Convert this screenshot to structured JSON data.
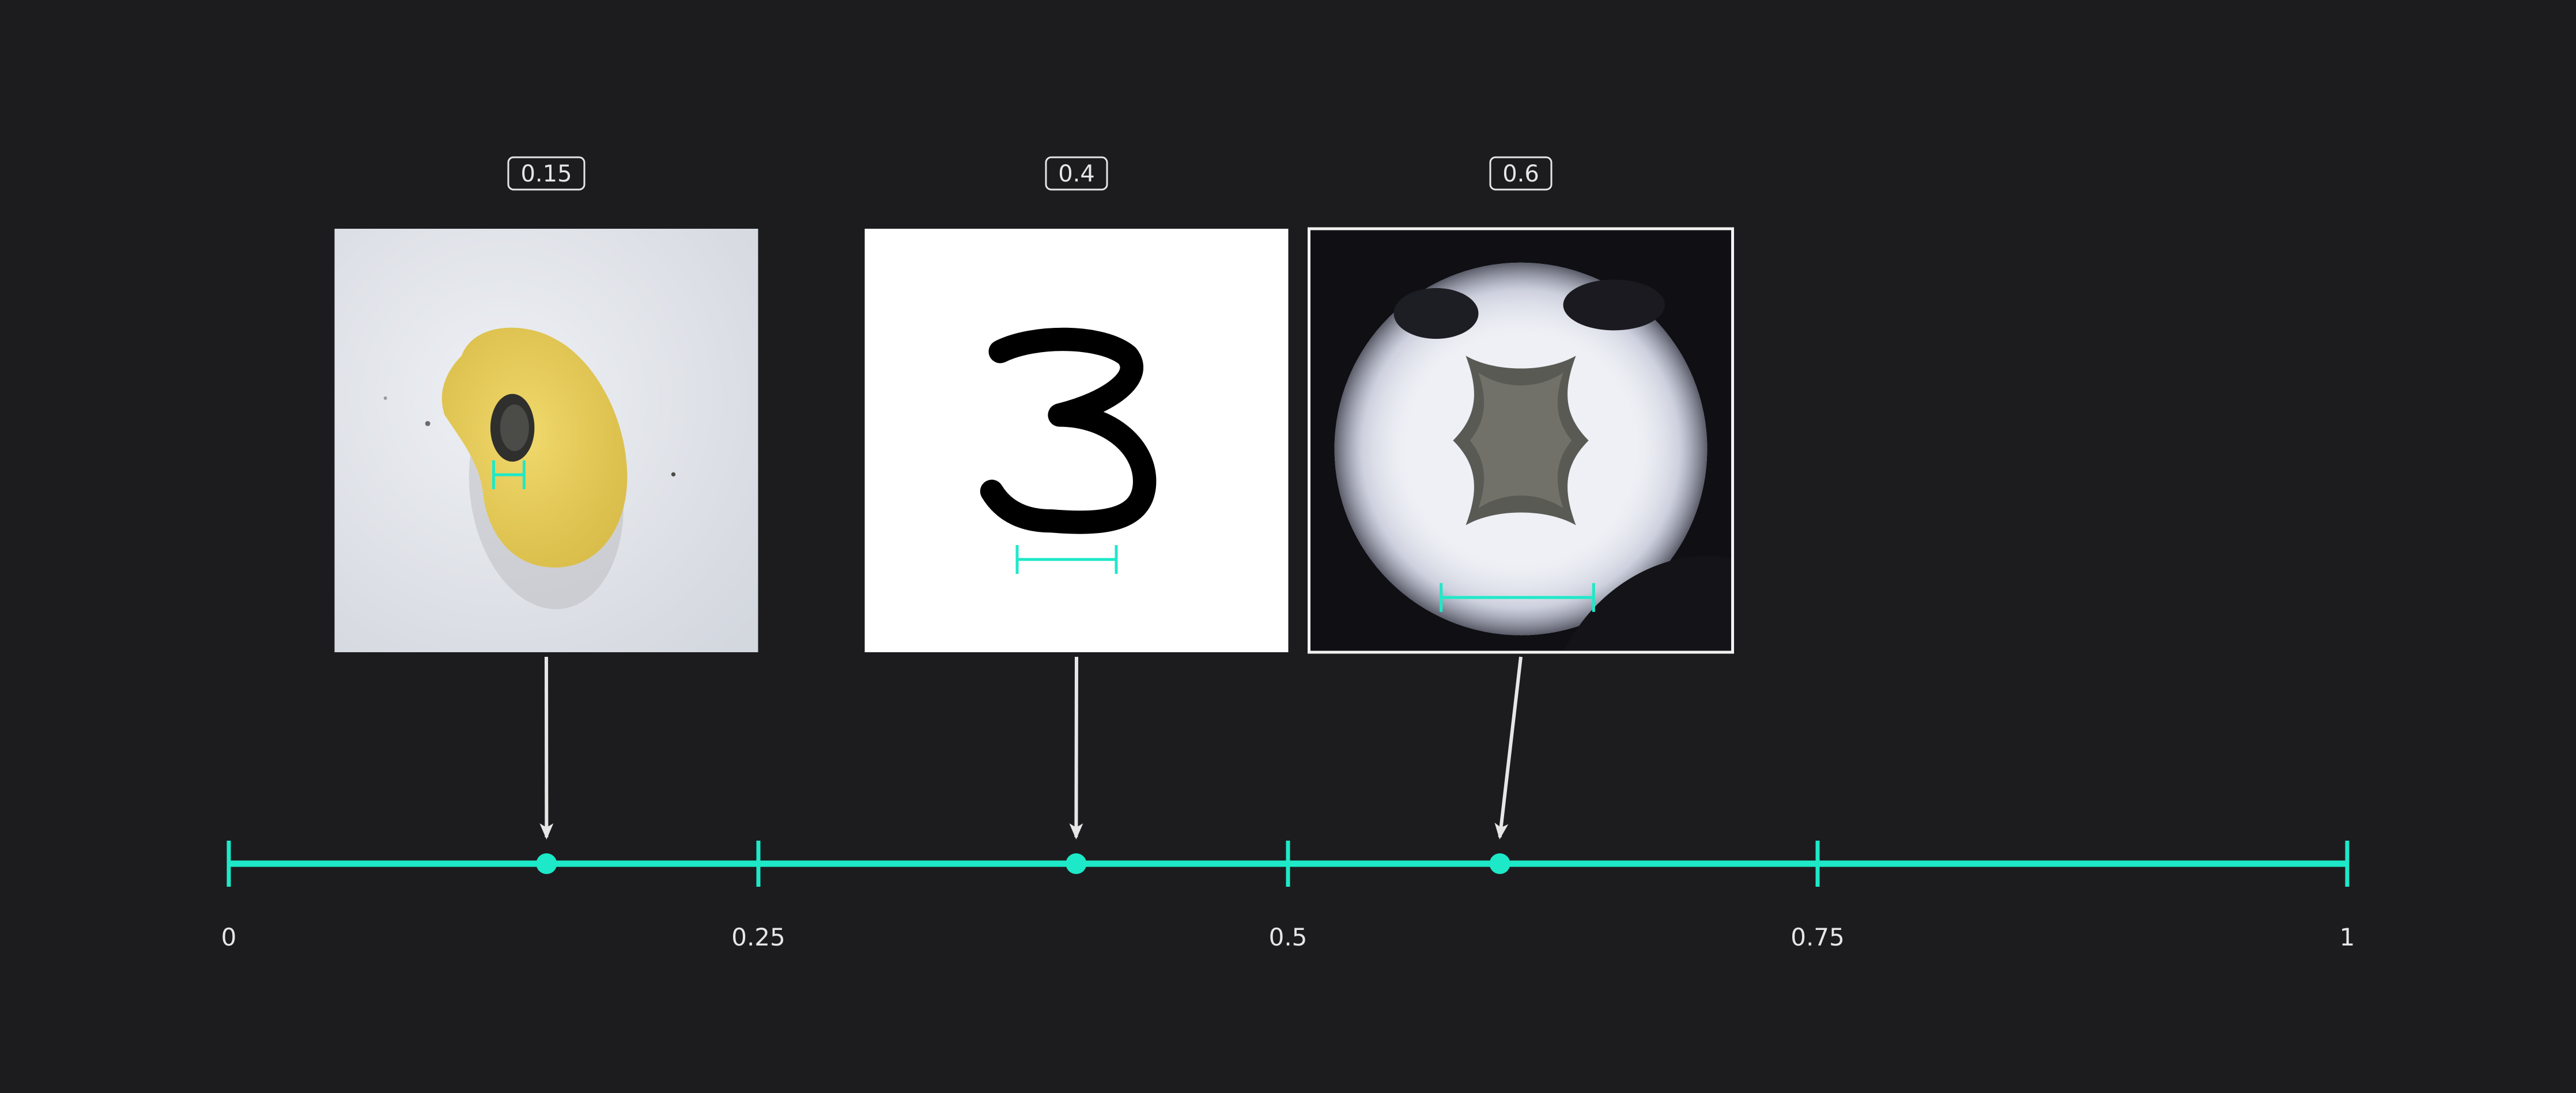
{
  "colors": {
    "background": "#1c1c1e",
    "accent": "#1de9c8",
    "foreground": "#e6e6e6"
  },
  "chart_data": {
    "type": "scatter",
    "xlim": [
      0,
      1
    ],
    "ticks": [
      {
        "value": 0,
        "label": "0"
      },
      {
        "value": 0.25,
        "label": "0.25"
      },
      {
        "value": 0.5,
        "label": "0.5"
      },
      {
        "value": 0.75,
        "label": "0.75"
      },
      {
        "value": 1,
        "label": "1"
      }
    ],
    "points": [
      {
        "value": 0.15,
        "label": "0.15",
        "image": "potato-chip-with-dark-spot",
        "scale_bar_fraction": 0.12
      },
      {
        "value": 0.4,
        "label": "0.4",
        "image": "handwritten-digit-three",
        "scale_bar_fraction": 0.39
      },
      {
        "value": 0.6,
        "label": "0.6",
        "image": "phillips-screw-head-closeup",
        "scale_bar_fraction": 0.6
      }
    ]
  }
}
